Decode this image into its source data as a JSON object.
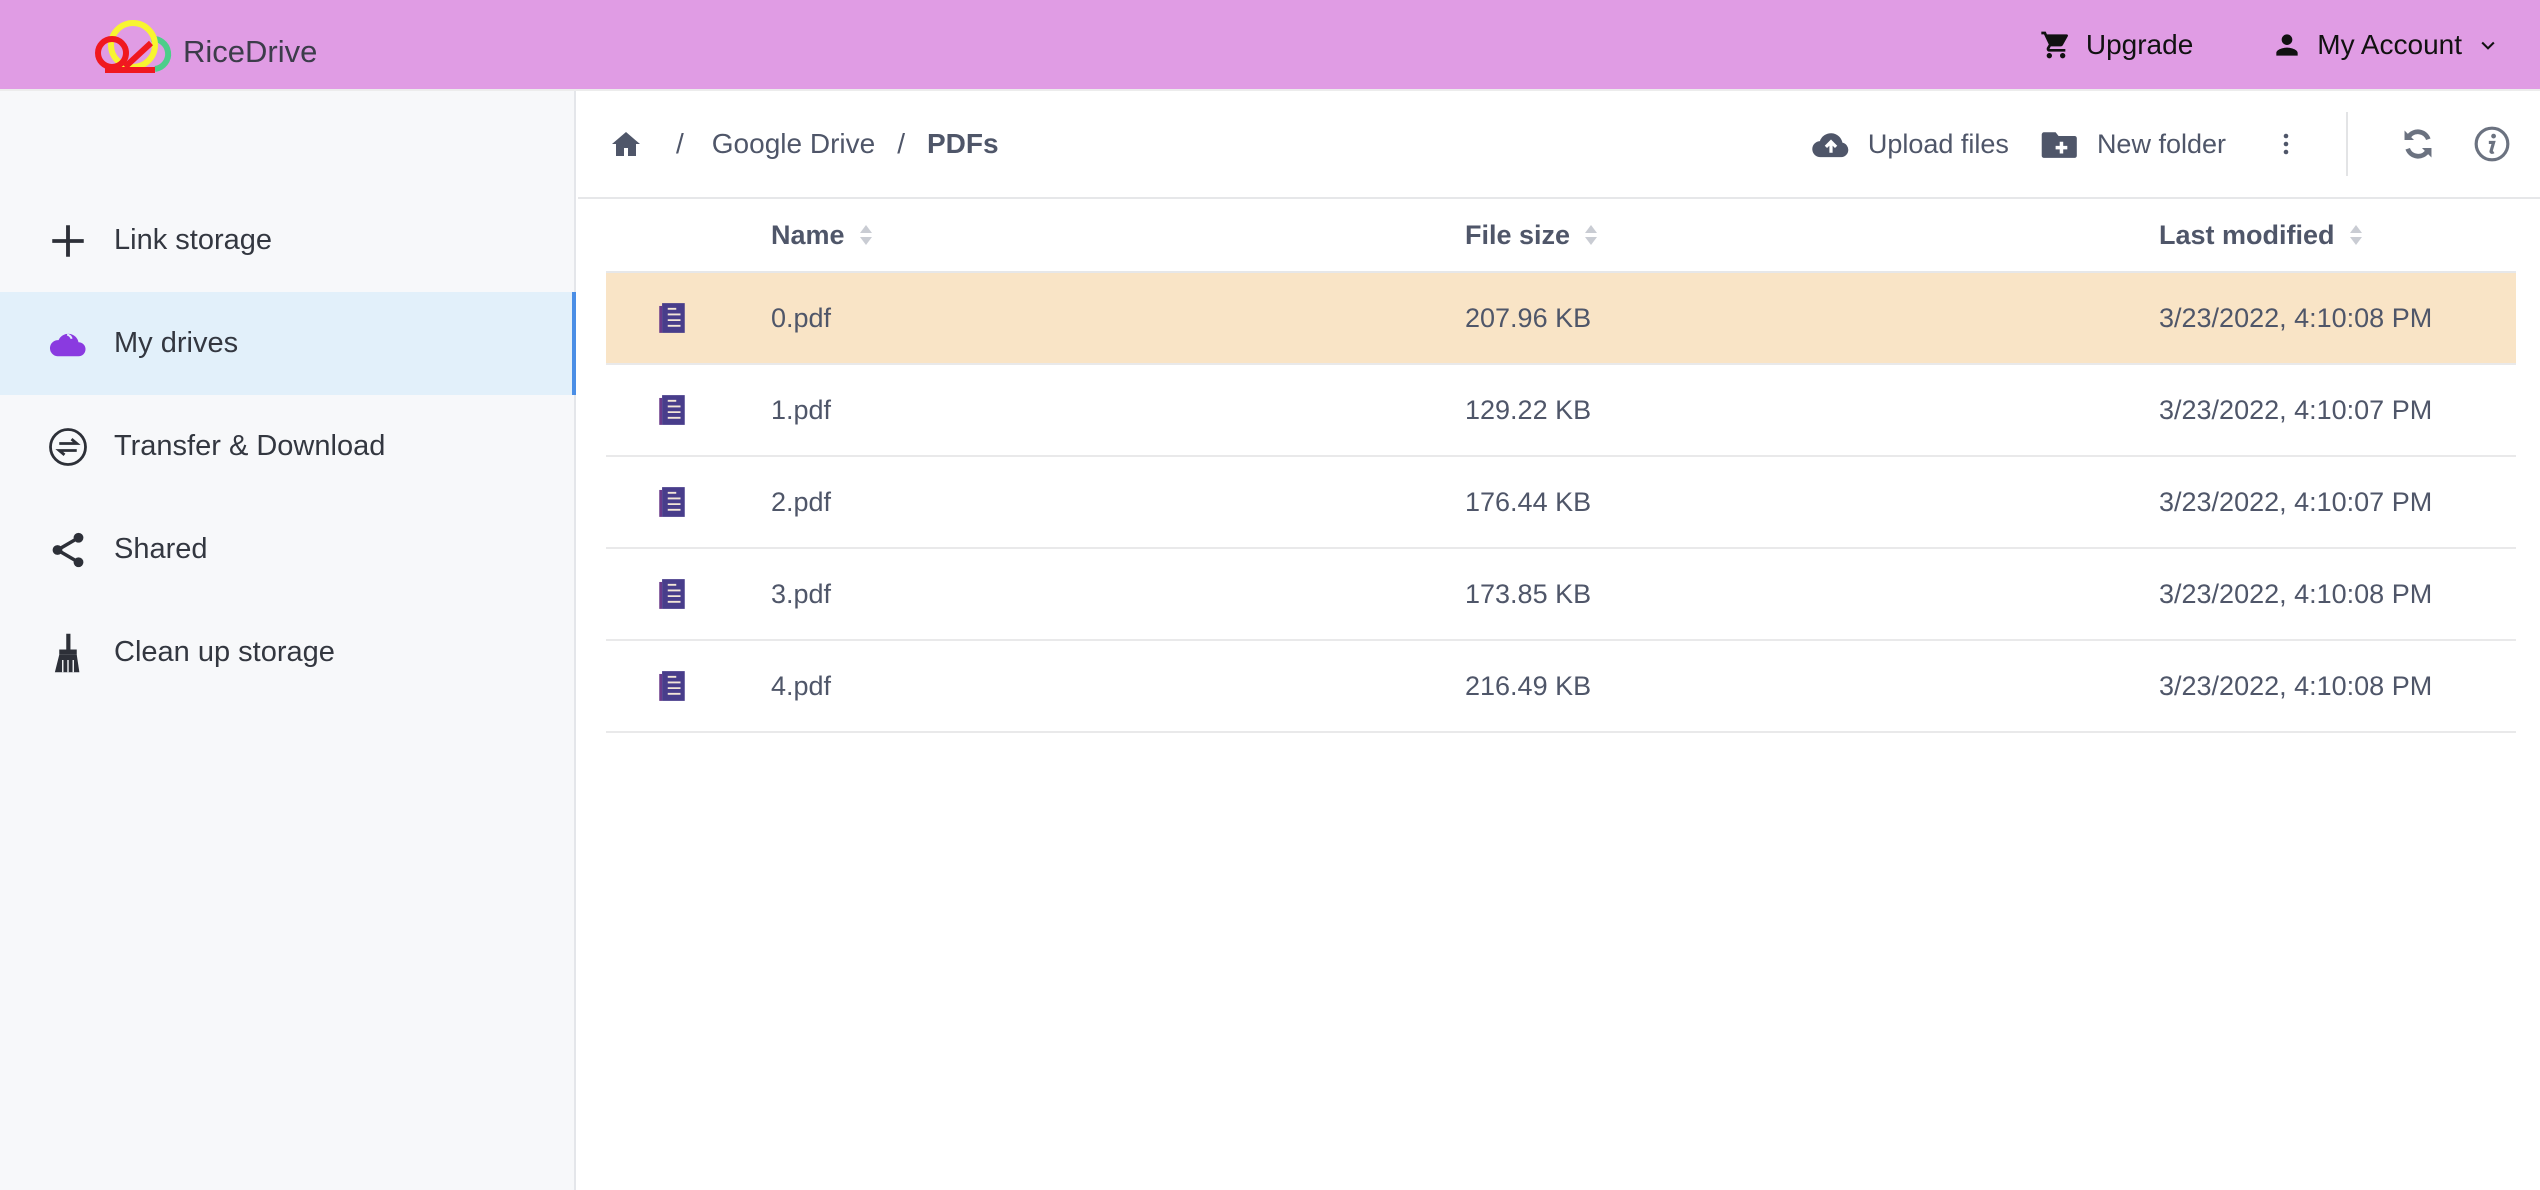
{
  "header": {
    "app_name": "RiceDrive",
    "upgrade_label": "Upgrade",
    "account_label": "My Account"
  },
  "sidebar": {
    "items": [
      {
        "label": "Link storage",
        "icon": "plus-icon",
        "active": false
      },
      {
        "label": "My drives",
        "icon": "cloud-icon",
        "active": true
      },
      {
        "label": "Transfer & Download",
        "icon": "transfer-icon",
        "active": false
      },
      {
        "label": "Shared",
        "icon": "share-icon",
        "active": false
      },
      {
        "label": "Clean up storage",
        "icon": "broom-icon",
        "active": false
      }
    ]
  },
  "breadcrumb": {
    "separator": "/",
    "items": [
      "Google Drive",
      "PDFs"
    ]
  },
  "toolbar": {
    "upload_label": "Upload files",
    "new_folder_label": "New folder"
  },
  "table": {
    "columns": [
      "Name",
      "File size",
      "Last modified"
    ],
    "rows": [
      {
        "name": "0.pdf",
        "size": "207.96 KB",
        "modified": "3/23/2022, 4:10:08 PM",
        "selected": true
      },
      {
        "name": "1.pdf",
        "size": "129.22 KB",
        "modified": "3/23/2022, 4:10:07 PM",
        "selected": false
      },
      {
        "name": "2.pdf",
        "size": "176.44 KB",
        "modified": "3/23/2022, 4:10:07 PM",
        "selected": false
      },
      {
        "name": "3.pdf",
        "size": "173.85 KB",
        "modified": "3/23/2022, 4:10:08 PM",
        "selected": false
      },
      {
        "name": "4.pdf",
        "size": "216.49 KB",
        "modified": "3/23/2022, 4:10:08 PM",
        "selected": false
      }
    ]
  },
  "colors": {
    "header_bg": "#e09ce4",
    "active_accent": "#4a8ee6",
    "selected_row": "#f9e4c6",
    "file_icon": "#483d8b",
    "cloud_icon": "#8a3ae0"
  }
}
